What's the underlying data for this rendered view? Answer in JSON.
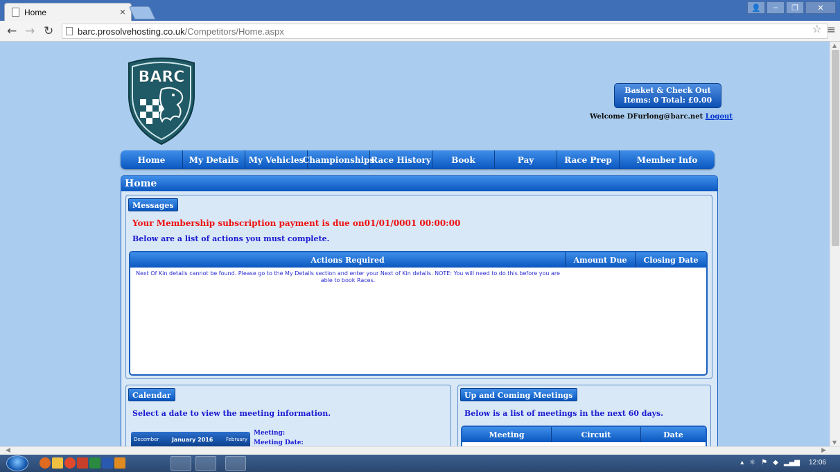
{
  "browser": {
    "tab_title": "Home",
    "tab_close": "×",
    "url_domain": "barc.prosolvehosting.co.uk",
    "url_path": "/Competitors/Home.aspx"
  },
  "header": {
    "logo_text": "BARC",
    "basket_line1": "Basket & Check Out",
    "basket_line2": "Items: 0 Total: £0.00",
    "welcome_text": "Welcome DFurlong@barc.net",
    "logout_label": "Logout"
  },
  "nav": {
    "items": [
      "Home",
      "My Details",
      "My Vehicles",
      "Championships",
      "Race History",
      "Book",
      "Pay",
      "Race Prep",
      "Member Info"
    ]
  },
  "panel": {
    "title": "Home"
  },
  "messages": {
    "label": "Messages",
    "membership_notice": "Your Membership subscription payment is due on01/01/0001 00:00:00",
    "actions_intro": "Below are a list of actions you must complete.",
    "columns": [
      "Actions Required",
      "Amount Due",
      "Closing Date"
    ],
    "rows": [
      {
        "action": "Next Of Kin details cannot be found. Please go to the My Details section and enter your Next of Kin details. NOTE: You will need to do this before you are able to book Races.",
        "amount": "",
        "closing": ""
      }
    ]
  },
  "calendar": {
    "label": "Calendar",
    "instruction": "Select a date to view the meeting information.",
    "prev_month": "December",
    "current_month": "January 2016",
    "next_month": "February",
    "meeting_label": "Meeting:",
    "meeting_date_label": "Meeting Date:"
  },
  "upcoming": {
    "label": "Up and Coming Meetings",
    "intro": "Below is a list of meetings in the next 60 days.",
    "columns": [
      "Meeting",
      "Circuit",
      "Date"
    ]
  },
  "taskbar": {
    "clock": "12:06"
  },
  "colors": {
    "page_bg": "#a9ccef",
    "nav_blue": "#0a57c0",
    "alert_red": "#ee1111",
    "text_blue": "#1a1ad0"
  }
}
